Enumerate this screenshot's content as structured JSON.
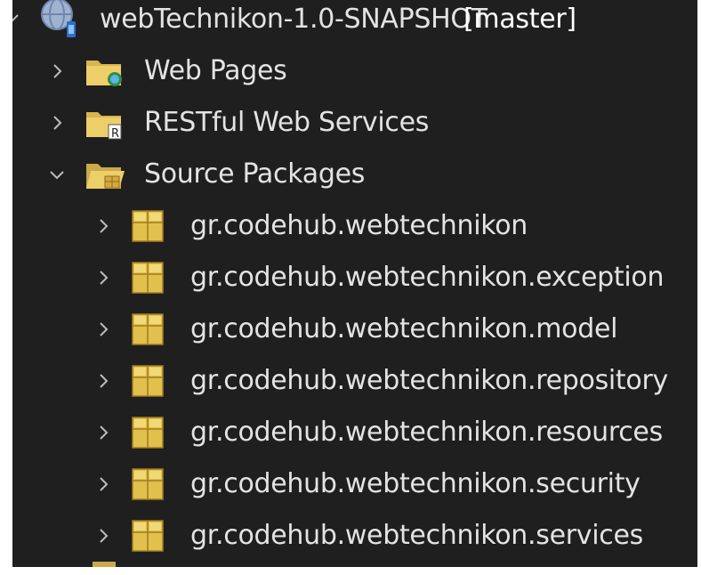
{
  "project": {
    "name": "webTechnikon-1.0-SNAPSHOT",
    "branch": "[master]"
  },
  "nodes": [
    {
      "label": "Web Pages",
      "icon": "web-pages-folder-icon",
      "expanded": false
    },
    {
      "label": "RESTful Web Services",
      "icon": "restful-folder-icon",
      "expanded": false
    },
    {
      "label": "Source Packages",
      "icon": "source-packages-folder-icon",
      "expanded": true
    }
  ],
  "packages": [
    "gr.codehub.webtechnikon",
    "gr.codehub.webtechnikon.exception",
    "gr.codehub.webtechnikon.model",
    "gr.codehub.webtechnikon.repository",
    "gr.codehub.webtechnikon.resources",
    "gr.codehub.webtechnikon.security",
    "gr.codehub.webtechnikon.services"
  ],
  "colors": {
    "background": "#1f1f1f",
    "text": "#e3e3e3",
    "folder": "#d9b450",
    "package": "#e2c04e"
  }
}
